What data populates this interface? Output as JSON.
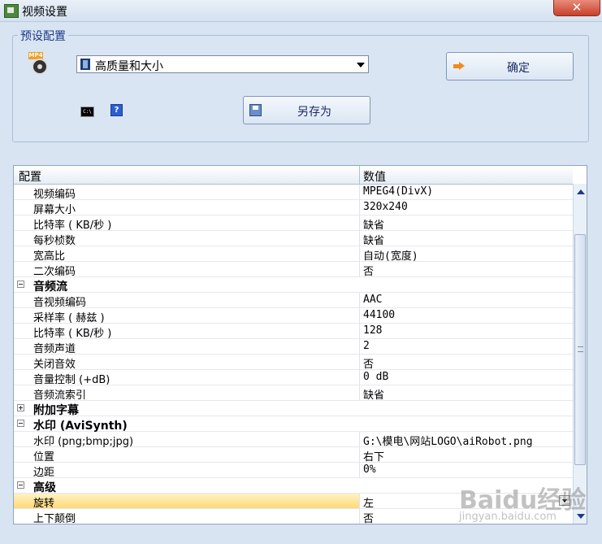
{
  "window": {
    "title": "视频设置",
    "close_label": "✕"
  },
  "preset": {
    "legend": "预设配置",
    "icon_badge": "MP4",
    "selected": "高质量和大小",
    "ok_label": "确定",
    "saveas_label": "另存为",
    "cmd_icon_text": "C:\\",
    "help_icon_text": "?"
  },
  "grid": {
    "col_config": "配置",
    "col_value": "数值",
    "rows": [
      {
        "key": "视频编码",
        "value": "MPEG4(DivX)"
      },
      {
        "key": "屏幕大小",
        "value": "320x240"
      },
      {
        "key": "比特率 ( KB/秒 )",
        "value": "缺省"
      },
      {
        "key": "每秒桢数",
        "value": "缺省"
      },
      {
        "key": "宽高比",
        "value": "自动(宽度)"
      },
      {
        "key": "二次编码",
        "value": "否"
      },
      {
        "key": "音频流",
        "category": true,
        "expanded": true
      },
      {
        "key": "音视频编码",
        "value": "AAC"
      },
      {
        "key": "采样率 ( 赫兹 )",
        "value": "44100"
      },
      {
        "key": "比特率 ( KB/秒 )",
        "value": "128"
      },
      {
        "key": "音频声道",
        "value": "2"
      },
      {
        "key": "关闭音效",
        "value": "否"
      },
      {
        "key": "音量控制 (+dB)",
        "value": "0 dB"
      },
      {
        "key": "音频流索引",
        "value": "缺省"
      },
      {
        "key": "附加字幕",
        "category": true,
        "expanded": false
      },
      {
        "key": "水印 (AviSynth)",
        "category": true,
        "expanded": true
      },
      {
        "key": "水印 (png;bmp;jpg)",
        "value": "G:\\模电\\网站LOGO\\aiRobot.png"
      },
      {
        "key": "位置",
        "value": "右下"
      },
      {
        "key": "边距",
        "value": "0%"
      },
      {
        "key": "高级",
        "category": true,
        "expanded": true
      },
      {
        "key": "旋转",
        "value": "左",
        "selected": true
      },
      {
        "key": "上下颠倒",
        "value": "否"
      }
    ]
  },
  "watermark": {
    "text": "Baidu经验",
    "sub": "jingyan.baidu.com"
  },
  "colors": {
    "accent": "#1e3a8a",
    "selected_row": "#ffd97a",
    "window_bg": "#d8e4f1"
  }
}
